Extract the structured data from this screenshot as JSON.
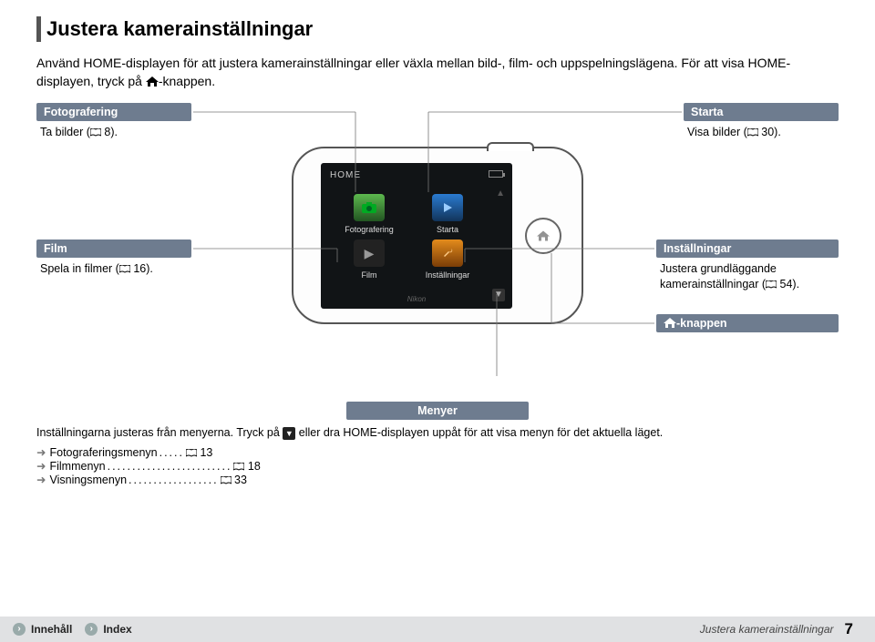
{
  "title": "Justera kamerainställningar",
  "intro_a": "Använd HOME-displayen för att justera kamerainställningar eller växla mellan bild-, film- och uppspelningslägena. För att visa HOME-displayen, tryck på ",
  "intro_b": "-knappen.",
  "labels": {
    "fotografering": {
      "hdr": "Fotografering",
      "txt_a": "Ta bilder (",
      "txt_b": " 8)."
    },
    "starta": {
      "hdr": "Starta",
      "txt_a": "Visa bilder (",
      "txt_b": " 30)."
    },
    "film": {
      "hdr": "Film",
      "txt_a": "Spela in filmer (",
      "txt_b": " 16)."
    },
    "installningar": {
      "hdr": "Inställningar",
      "txt_a": "Justera grundläggande kamerainställningar (",
      "txt_b": " 54)."
    },
    "knappen": {
      "hdr_suffix": "-knappen"
    }
  },
  "screen": {
    "home": "HOME",
    "cells": {
      "fotografering": "Fotografering",
      "starta": "Starta",
      "film": "Film",
      "installningar": "Inställningar"
    },
    "brand": "Nikon"
  },
  "menyer": {
    "hdr": "Menyer",
    "txt_a": "Inställningarna justeras från menyerna. Tryck på ",
    "txt_b": " eller dra HOME-displayen uppåt för att visa menyn för det aktuella läget."
  },
  "links": [
    {
      "label": "Fotograferingsmenyn",
      "dots": ".....",
      "page": "13"
    },
    {
      "label": "Filmmenyn",
      "dots": ".........................",
      "page": "18"
    },
    {
      "label": "Visningsmenyn",
      "dots": "..................",
      "page": "33"
    }
  ],
  "footer": {
    "innehall": "Innehåll",
    "index": "Index",
    "breadcrumb": "Justera kamerainställningar",
    "page": "7"
  }
}
